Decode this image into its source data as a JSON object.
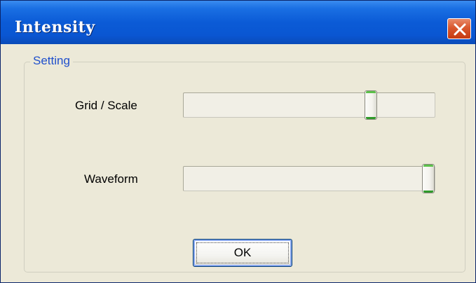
{
  "window": {
    "title": "Intensity"
  },
  "group": {
    "label": "Setting"
  },
  "sliders": [
    {
      "label": "Grid / Scale",
      "position_percent": 76
    },
    {
      "label": "Waveform",
      "position_percent": 100
    }
  ],
  "buttons": {
    "ok_label": "OK"
  },
  "icons": {
    "close": "close-icon"
  },
  "colors": {
    "titlebar": "#0b5bd6",
    "close_button": "#d9572e",
    "group_label": "#1f4fcc",
    "slider_thumb_accent": "#2f9a2a"
  }
}
